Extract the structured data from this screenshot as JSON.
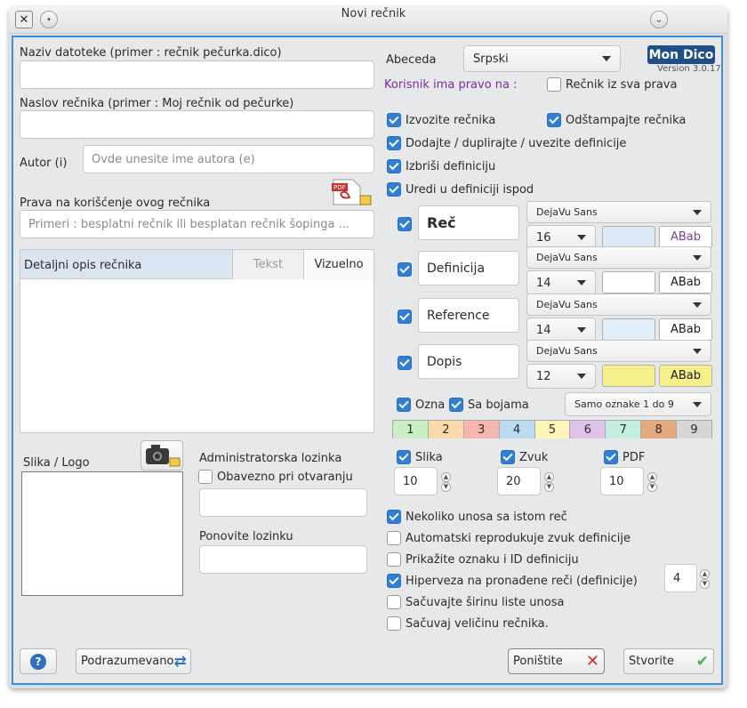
{
  "window": {
    "title": "Novi rečnik"
  },
  "left": {
    "filename_label": "Naziv datoteke (primer : rečnik pečurka.dico)",
    "filename_value": "",
    "title_label": "Naslov rečnika (primer : Moj rečnik od pečurke)",
    "title_value": "",
    "author_label": "Autor (i)",
    "author_placeholder": "Ovde unesite ime autora (e)",
    "rights_label": "Prava na korišćenje ovog rečnika",
    "rights_placeholder": "Primeri : besplatni rečnik ili besplatan rečnik šopinga ...",
    "desc_label": "Detaljni opis rečnika",
    "tab_text": "Tekst",
    "tab_visual": "Vizuelno",
    "image_label": "Slika / Logo",
    "admin_label": "Administratorska lozinka",
    "require_label": "Obavezno pri otvaranju",
    "repeat_label": "Ponovite lozinku"
  },
  "right": {
    "alphabet_label": "Abeceda",
    "alphabet_value": "Srpski",
    "logo_text": "Mon Dico",
    "version": "Version 3.0.17",
    "rights_header": "Korisnik ima pravo na :",
    "all_rights": "Rečnik iz sva prava",
    "export": "Izvozite rečnika",
    "print": "Odštampajte rečnika",
    "add": "Dodajte / duplirajte / uvezite definicije",
    "delete": "Izbriši definiciju",
    "edit": "Uredi u definiciji ispod",
    "fields": [
      {
        "name": "Reč",
        "font": "DejaVu Sans",
        "size": "16",
        "color": "#dde9f7",
        "sample": "ABab",
        "sample_bg": "#ffffff",
        "sample_color": "#7a3fa0",
        "bold": true
      },
      {
        "name": "Definicija",
        "font": "DejaVu Sans",
        "size": "14",
        "color": "#ffffff",
        "sample": "ABab",
        "sample_bg": "#ffffff",
        "sample_color": "#1a1a1a",
        "bold": false
      },
      {
        "name": "Reference",
        "font": "DejaVu Sans",
        "size": "14",
        "color": "#e3eefb",
        "sample": "ABab",
        "sample_bg": "#ffffff",
        "sample_color": "#1a1a1a",
        "bold": false
      },
      {
        "name": "Dopis",
        "font": "DejaVu Sans",
        "size": "12",
        "color": "#f7ef8a",
        "sample": "ABab",
        "sample_bg": "#f7ef8a",
        "sample_color": "#1a1a1a",
        "bold": false
      }
    ],
    "ozna": "Ozna",
    "colors_label": "Sa bojama",
    "marks_value": "Samo oznake 1 do 9",
    "palette": [
      {
        "n": "1",
        "c": "#c9edc4"
      },
      {
        "n": "2",
        "c": "#fbd9a8"
      },
      {
        "n": "3",
        "c": "#f6b6b0"
      },
      {
        "n": "4",
        "c": "#b9dcf2"
      },
      {
        "n": "5",
        "c": "#fbf6b8"
      },
      {
        "n": "6",
        "c": "#e1c2ea"
      },
      {
        "n": "7",
        "c": "#c2eee1"
      },
      {
        "n": "8",
        "c": "#e4a97d"
      },
      {
        "n": "9",
        "c": "#d6d6d6"
      }
    ],
    "slika": "Slika",
    "slika_value": "10",
    "zvuk": "Zvuk",
    "zvuk_value": "20",
    "pdf": "PDF",
    "pdf_value": "10",
    "multi": "Nekoliko unosa sa istom reč",
    "autoplay": "Automatski reprodukuje zvuk definicije",
    "show_id": "Prikažite oznaku i ID definiciju",
    "hyperlink": "Hiperveza na pronađene reči (definicije)",
    "hyperlink_value": "4",
    "save_width": "Sačuvajte širinu liste unosa",
    "save_size": "Sačuvaj veličinu rečnika."
  },
  "footer": {
    "help": "?",
    "defaults": "Podrazumevano",
    "cancel": "Poništite",
    "create": "Stvorite"
  }
}
